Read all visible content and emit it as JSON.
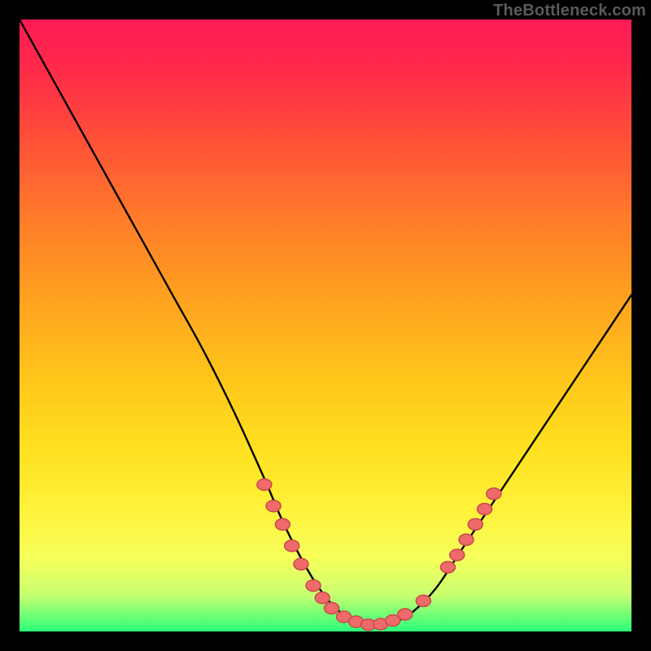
{
  "attribution": "TheBottleneck.com",
  "colors": {
    "page_bg": "#000000",
    "gradient_top": "#ff1a55",
    "gradient_mid": "#ffe020",
    "gradient_bottom": "#2aff7a",
    "curve_stroke": "#000000",
    "marker_fill": "#ef6a6a",
    "marker_stroke": "#c84a4a"
  },
  "chart_data": {
    "type": "line",
    "title": "",
    "xlabel": "",
    "ylabel": "",
    "xlim": [
      0,
      100
    ],
    "ylim": [
      0,
      100
    ],
    "grid": false,
    "series": [
      {
        "name": "bottleneck-curve",
        "x": [
          0,
          5,
          10,
          15,
          20,
          25,
          30,
          35,
          40,
          43,
          46,
          49,
          52,
          55,
          58,
          61,
          64,
          68,
          72,
          76,
          80,
          85,
          90,
          95,
          100
        ],
        "y": [
          100,
          91,
          82,
          73,
          64,
          55,
          46,
          36,
          25,
          18,
          12,
          7,
          3.5,
          1.8,
          1,
          1.5,
          3,
          7,
          13,
          19,
          25,
          32.5,
          40,
          47.5,
          55
        ]
      }
    ],
    "markers": [
      {
        "x": 40.0,
        "y": 24.0
      },
      {
        "x": 41.5,
        "y": 20.5
      },
      {
        "x": 43.0,
        "y": 17.5
      },
      {
        "x": 44.5,
        "y": 14.0
      },
      {
        "x": 46.0,
        "y": 11.0
      },
      {
        "x": 48.0,
        "y": 7.5
      },
      {
        "x": 49.5,
        "y": 5.5
      },
      {
        "x": 51.0,
        "y": 3.8
      },
      {
        "x": 53.0,
        "y": 2.4
      },
      {
        "x": 55.0,
        "y": 1.6
      },
      {
        "x": 57.0,
        "y": 1.1
      },
      {
        "x": 59.0,
        "y": 1.2
      },
      {
        "x": 61.0,
        "y": 1.8
      },
      {
        "x": 63.0,
        "y": 2.8
      },
      {
        "x": 66.0,
        "y": 5.0
      },
      {
        "x": 70.0,
        "y": 10.5
      },
      {
        "x": 71.5,
        "y": 12.5
      },
      {
        "x": 73.0,
        "y": 15.0
      },
      {
        "x": 74.5,
        "y": 17.5
      },
      {
        "x": 76.0,
        "y": 20.0
      },
      {
        "x": 77.5,
        "y": 22.5
      }
    ]
  }
}
